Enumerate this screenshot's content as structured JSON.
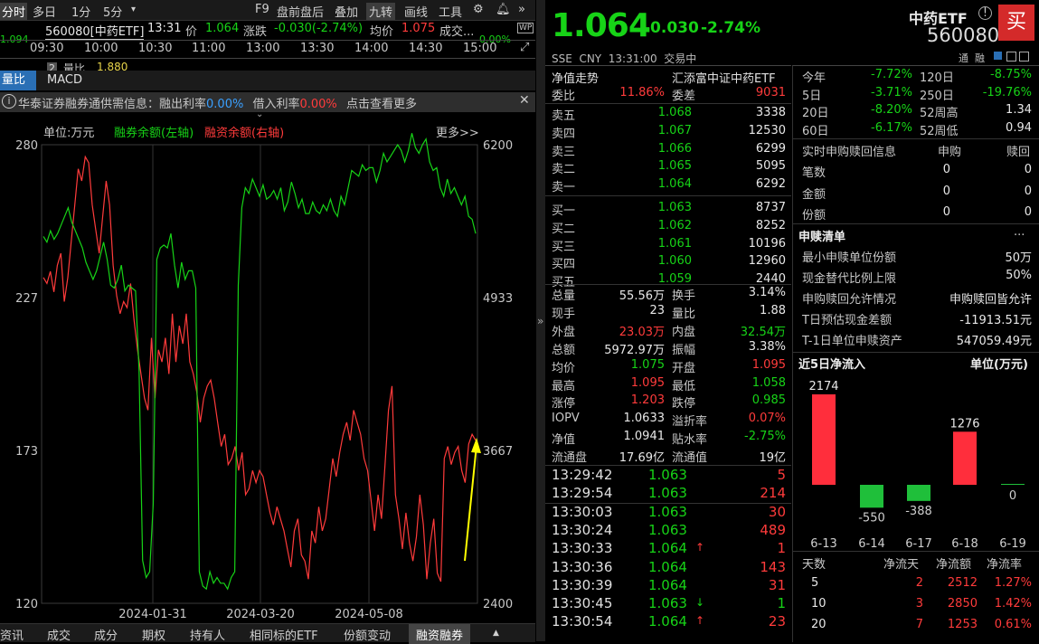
{
  "toolbar": {
    "items": [
      "分时",
      "多日",
      "1分",
      "5分",
      "▾",
      "F9",
      "盘前盘后",
      "叠加",
      "九转",
      "画线",
      "工具"
    ],
    "icons": [
      "settings-icon",
      "bell-icon",
      "chevron-right-icon"
    ]
  },
  "header_line": {
    "code_name": "560080[中药ETF]",
    "time": "13:31",
    "price_label": "价",
    "price": "1.064",
    "change_label": "涨跌",
    "change": "-0.030(-2.74%)",
    "avg_label": "均价",
    "avg": "1.075",
    "volume_label": "成交...",
    "left_price": "1.094",
    "right_pct": "0.00%"
  },
  "time_axis": [
    "09:30",
    "10:00",
    "10:30",
    "11:00",
    "13:00",
    "13:30",
    "14:00",
    "14:30",
    "15:00"
  ],
  "volume_ratio": {
    "label": "量比",
    "value": "1.880",
    "index": "2"
  },
  "chart_tabs": [
    "量比",
    "MACD"
  ],
  "info_bar": {
    "text_a": "华泰证券融券通供需信息：融出利率",
    "rate1": "0.00%",
    "text_b": "借入利率",
    "rate2": "0.00%",
    "text_c": "点击查看更多"
  },
  "margin_chart": {
    "unit": "单位:万元",
    "legend_green": "融券余额(左轴)",
    "legend_red": "融资余额(右轴)",
    "more": "更多>>",
    "left_ticks": [
      "280",
      "227",
      "173",
      "120"
    ],
    "right_ticks": [
      "6200",
      "4933",
      "3667",
      "2400"
    ],
    "x_ticks": [
      "2024-01-31",
      "2024-03-20",
      "2024-05-08"
    ]
  },
  "chart_data": {
    "type": "line",
    "title": "",
    "xlabel": "",
    "ylabel": "单位:万元",
    "y_left_lim": [
      120,
      280
    ],
    "y_right_lim": [
      2400,
      6200
    ],
    "x_ticks": [
      "2024-01-31",
      "2024-03-20",
      "2024-05-08"
    ],
    "legend": "top",
    "series": [
      {
        "name": "融券余额(左轴)",
        "axis": "left",
        "color": "#17d317",
        "values": [
          248,
          246,
          250,
          247,
          249,
          252,
          255,
          258,
          253,
          250,
          247,
          244,
          239,
          236,
          233,
          236,
          241,
          246,
          240,
          231,
          230,
          233,
          238,
          229,
          231,
          230,
          229,
          201,
          135,
          129,
          131,
          155,
          240,
          244,
          245,
          244,
          249,
          238,
          230,
          239,
          233,
          236,
          236,
          230,
          131,
          126,
          125,
          131,
          127,
          129,
          127,
          127,
          125,
          129,
          131,
          231,
          258,
          265,
          263,
          268,
          265,
          262,
          266,
          261,
          262,
          264,
          261,
          265,
          257,
          260,
          267,
          263,
          258,
          261,
          256,
          256,
          260,
          257,
          256,
          259,
          257,
          261,
          257,
          255,
          262,
          259,
          265,
          271,
          270,
          269,
          273,
          271,
          272,
          272,
          267,
          271,
          277,
          274,
          276,
          278,
          280,
          278,
          274,
          278,
          284,
          279,
          277,
          280,
          282,
          274,
          271,
          272,
          265,
          262,
          268,
          263,
          265,
          262,
          259,
          262,
          255,
          254,
          249
        ]
      },
      {
        "name": "融资余额(右轴)",
        "axis": "right",
        "color": "#ff3b3b",
        "values": [
          5100,
          5050,
          5150,
          4980,
          5200,
          5300,
          4900,
          5100,
          5400,
          5700,
          6000,
          5900,
          6100,
          6050,
          5700,
          5500,
          5300,
          5600,
          5900,
          5700,
          5200,
          4950,
          4800,
          4900,
          4850,
          5050,
          4750,
          4500,
          4300,
          4100,
          4000,
          4600,
          4100,
          4500,
          4400,
          4600,
          4300,
          4800,
          4400,
          4700,
          4550,
          4800,
          4400,
          4300,
          4150,
          3900,
          4100,
          4200,
          4250,
          4100,
          3900,
          3700,
          3800,
          3550,
          3600,
          3700,
          3500,
          3650,
          3300,
          3350,
          3500,
          3400,
          3500,
          3450,
          3300,
          3150,
          3050,
          3200,
          3100,
          3000,
          2850,
          2700,
          3000,
          3100,
          2800,
          2750,
          2600,
          3000,
          2900,
          3200,
          3000,
          3100,
          3350,
          3600,
          3450,
          3650,
          3800,
          3900,
          3750,
          4000,
          3900,
          3800,
          3600,
          3500,
          3250,
          3000,
          3300,
          3100,
          3550,
          4000,
          4200,
          3300,
          3100,
          2850,
          3150,
          2900,
          2750,
          2950,
          3300,
          3050,
          2600,
          2900,
          3100,
          2650,
          2580,
          3600,
          3700,
          3550,
          3650,
          3700,
          3500,
          3400,
          3720,
          3800,
          3750
        ]
      }
    ],
    "annotations": [
      "yellow-arrow"
    ]
  },
  "quote": {
    "price": "1.064",
    "change": "-0.030",
    "pct": "-2.74%",
    "name": "中药ETF",
    "code": "560080",
    "buy_label": "买",
    "market_line": "SSE  CNY  13:31:00  交易中",
    "tags": "通  融"
  },
  "order_book": {
    "title": "净值走势",
    "fund_name": "汇添富中证中药ETF",
    "weibi_label": "委比",
    "weibi": "11.86%",
    "weicha_label": "委差",
    "weicha": "9031",
    "sells": [
      {
        "label": "卖五",
        "price": "1.068",
        "vol": "3338"
      },
      {
        "label": "卖四",
        "price": "1.067",
        "vol": "12530"
      },
      {
        "label": "卖三",
        "price": "1.066",
        "vol": "6299"
      },
      {
        "label": "卖二",
        "price": "1.065",
        "vol": "5095"
      },
      {
        "label": "卖一",
        "price": "1.064",
        "vol": "6292"
      }
    ],
    "buys": [
      {
        "label": "买一",
        "price": "1.063",
        "vol": "8737"
      },
      {
        "label": "买二",
        "price": "1.062",
        "vol": "8252"
      },
      {
        "label": "买三",
        "price": "1.061",
        "vol": "10196"
      },
      {
        "label": "买四",
        "price": "1.060",
        "vol": "12960"
      },
      {
        "label": "买五",
        "price": "1.059",
        "vol": "2440"
      }
    ]
  },
  "stats": [
    [
      {
        "l": "总量",
        "v": "55.56万",
        "c": "ac"
      },
      {
        "l": "换手",
        "v": "3.14%",
        "c": "ac"
      }
    ],
    [
      {
        "l": "现手",
        "v": "23",
        "c": "ac"
      },
      {
        "l": "量比",
        "v": "1.88",
        "c": "ac"
      }
    ],
    [
      {
        "l": "外盘",
        "v": "23.03万",
        "c": "red"
      },
      {
        "l": "内盘",
        "v": "32.54万",
        "c": "green"
      }
    ],
    [
      {
        "l": "总额",
        "v": "5972.97万",
        "c": "ac"
      },
      {
        "l": "振幅",
        "v": "3.38%",
        "c": "ac"
      }
    ],
    [
      {
        "l": "均价",
        "v": "1.075",
        "c": "green"
      },
      {
        "l": "开盘",
        "v": "1.095",
        "c": "red"
      }
    ],
    [
      {
        "l": "最高",
        "v": "1.095",
        "c": "red"
      },
      {
        "l": "最低",
        "v": "1.058",
        "c": "green"
      }
    ],
    [
      {
        "l": "涨停",
        "v": "1.203",
        "c": "red"
      },
      {
        "l": "跌停",
        "v": "0.985",
        "c": "green"
      }
    ],
    [
      {
        "l": "IOPV",
        "v": "1.0633",
        "c": "ac"
      },
      {
        "l": "溢折率",
        "v": "0.07%",
        "c": "red"
      }
    ],
    [
      {
        "l": "净值",
        "v": "1.0941",
        "c": "ac"
      },
      {
        "l": "贴水率",
        "v": "-2.75%",
        "c": "green"
      }
    ],
    [
      {
        "l": "流通盘",
        "v": "17.69亿",
        "c": "ac"
      },
      {
        "l": "流通值",
        "v": "19亿",
        "c": "ac"
      }
    ]
  ],
  "ticks": [
    {
      "t": "13:29:42",
      "p": "1.063",
      "v": "5",
      "vc": "red",
      "arrow": ""
    },
    {
      "t": "13:29:54",
      "p": "1.063",
      "v": "214",
      "vc": "red",
      "arrow": ""
    },
    {
      "t": "13:30:03",
      "p": "1.063",
      "v": "30",
      "vc": "red",
      "arrow": ""
    },
    {
      "t": "13:30:24",
      "p": "1.063",
      "v": "489",
      "vc": "red",
      "arrow": ""
    },
    {
      "t": "13:30:33",
      "p": "1.064",
      "v": "1",
      "vc": "red",
      "arrow": "up"
    },
    {
      "t": "13:30:36",
      "p": "1.064",
      "v": "143",
      "vc": "red",
      "arrow": ""
    },
    {
      "t": "13:30:39",
      "p": "1.064",
      "v": "31",
      "vc": "red",
      "arrow": ""
    },
    {
      "t": "13:30:45",
      "p": "1.063",
      "v": "1",
      "vc": "green",
      "arrow": "down"
    },
    {
      "t": "13:30:54",
      "p": "1.064",
      "v": "23",
      "vc": "red",
      "arrow": "up"
    }
  ],
  "perf": [
    [
      {
        "l": "今年",
        "v": "-7.72%"
      },
      {
        "l": "120日",
        "v": "-8.75%"
      }
    ],
    [
      {
        "l": "5日",
        "v": "-3.71%"
      },
      {
        "l": "250日",
        "v": "-19.76%"
      }
    ],
    [
      {
        "l": "20日",
        "v": "-8.20%"
      },
      {
        "l": "52周高",
        "v": "1.34"
      }
    ],
    [
      {
        "l": "60日",
        "v": "-6.17%"
      },
      {
        "l": "52周低",
        "v": "0.94"
      }
    ]
  ],
  "realtime": {
    "title": "实时申购赎回信息",
    "col1": "申购",
    "col2": "赎回",
    "rows": [
      {
        "l": "笔数",
        "a": "0",
        "b": "0"
      },
      {
        "l": "金额",
        "a": "0",
        "b": "0"
      },
      {
        "l": "份额",
        "a": "0",
        "b": "0"
      }
    ]
  },
  "creation": {
    "title": "申赎清单",
    "more": "...",
    "rows": [
      {
        "l": "最小申赎单位份额",
        "v": "50万"
      },
      {
        "l": "现金替代比例上限",
        "v": "50%"
      },
      {
        "l": "申购赎回允许情况",
        "v": "申购赎回皆允许"
      },
      {
        "l": "T日预估现金差额",
        "v": "-11913.51元"
      },
      {
        "l": "T-1日单位申赎资产",
        "v": "547059.49元"
      }
    ]
  },
  "netflow": {
    "title": "近5日净流入",
    "unit": "单位(万元)",
    "bars": [
      {
        "date": "6-13",
        "value": 2174
      },
      {
        "date": "6-14",
        "value": -550
      },
      {
        "date": "6-17",
        "value": -388
      },
      {
        "date": "6-18",
        "value": 1276
      },
      {
        "date": "6-19",
        "value": 0
      }
    ],
    "table_headers": [
      "天数",
      "净流天",
      "净流额",
      "净流率"
    ],
    "table_rows": [
      [
        "5",
        "2",
        "2512",
        "1.27%"
      ],
      [
        "10",
        "3",
        "2850",
        "1.42%"
      ],
      [
        "20",
        "7",
        "1253",
        "0.61%"
      ]
    ]
  },
  "bottom_tabs": [
    "资讯",
    "成交",
    "成分",
    "期权",
    "持有人",
    "相同标的ETF",
    "份额变动",
    "融资融券",
    "▲"
  ]
}
